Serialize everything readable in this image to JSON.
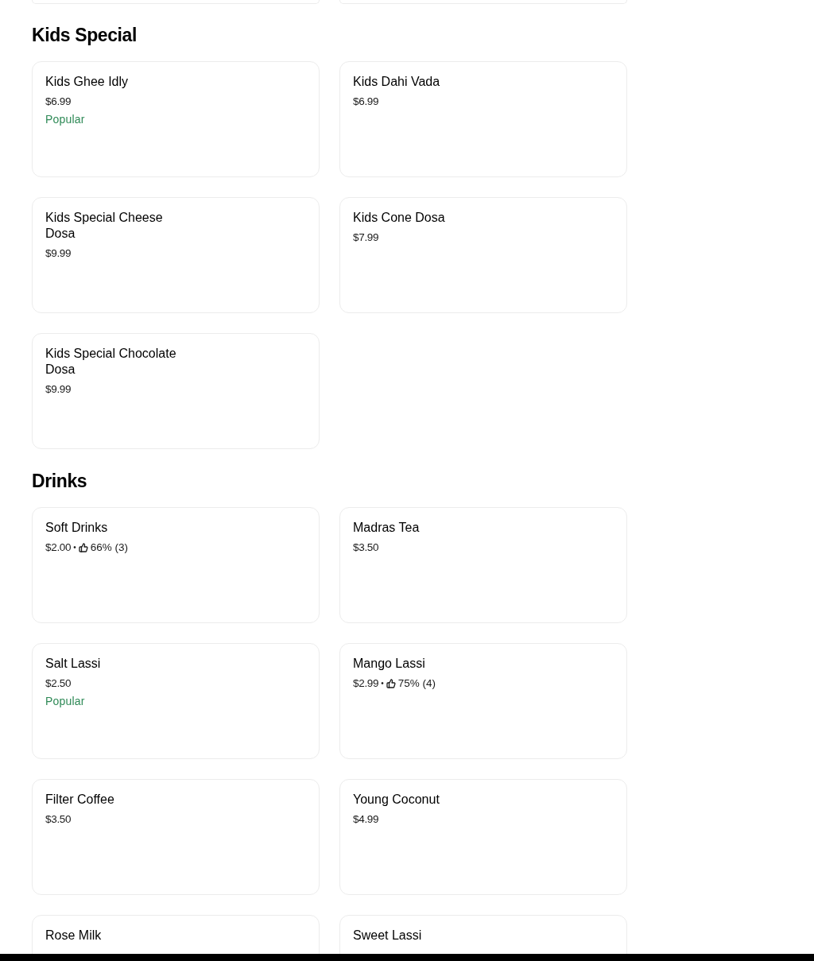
{
  "sections": [
    {
      "title": "Kids Special",
      "items": [
        {
          "name": "Kids Ghee Idly",
          "price": "$6.99",
          "badge": "Popular"
        },
        {
          "name": "Kids Dahi Vada",
          "price": "$6.99"
        },
        {
          "name": "Kids Special Cheese Dosa",
          "price": "$9.99"
        },
        {
          "name": "Kids Cone Dosa",
          "price": "$7.99"
        },
        {
          "name": "Kids Special Chocolate Dosa",
          "price": "$9.99"
        }
      ]
    },
    {
      "title": "Drinks",
      "items": [
        {
          "name": "Soft Drinks",
          "price": "$2.00",
          "separator": "•",
          "rating": "66% (3)"
        },
        {
          "name": "Madras Tea",
          "price": "$3.50"
        },
        {
          "name": "Salt Lassi",
          "price": "$2.50",
          "badge": "Popular"
        },
        {
          "name": "Mango Lassi",
          "price": "$2.99",
          "separator": "•",
          "rating": "75% (4)"
        },
        {
          "name": "Filter Coffee",
          "price": "$3.50"
        },
        {
          "name": "Young Coconut",
          "price": "$4.99"
        },
        {
          "name": "Rose Milk"
        },
        {
          "name": "Sweet Lassi"
        }
      ]
    }
  ]
}
